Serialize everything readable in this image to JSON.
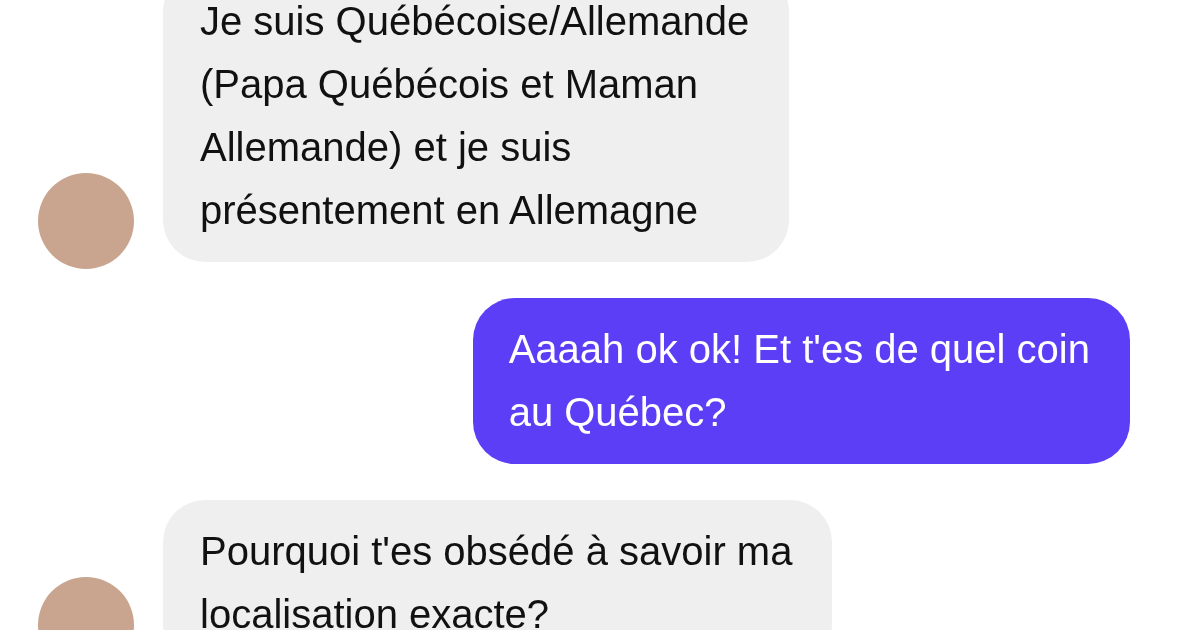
{
  "messages": [
    {
      "kind": "received",
      "text": "Je suis Québécoise/Allemande\n(Papa Québécois et Maman\nAllemande) et je suis\nprésentement en Allemagne"
    },
    {
      "kind": "sent",
      "text": "Aaaah ok ok! Et t'es de quel coin\nau Québec?"
    },
    {
      "kind": "received",
      "text": "Pourquoi t'es obsédé à savoir ma\nlocalisation exacte?"
    }
  ]
}
